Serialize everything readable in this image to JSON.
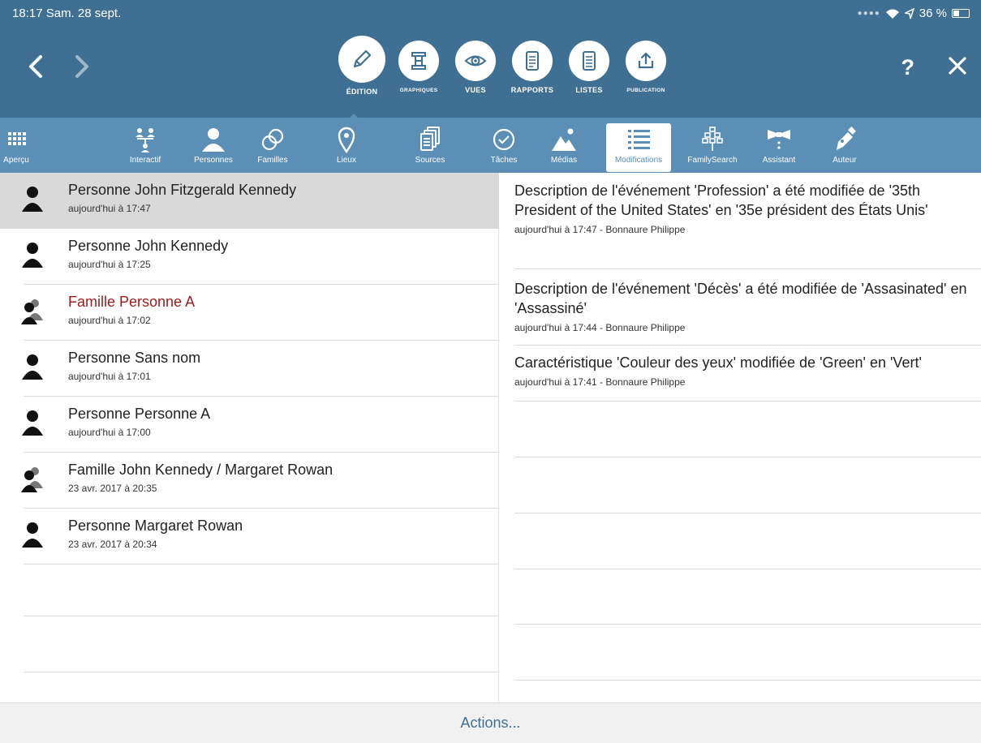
{
  "status": {
    "time": "18:17",
    "date": "Sam. 28 sept.",
    "battery": "36 %"
  },
  "header": {
    "help_label": "?",
    "modes": [
      {
        "label": "ÉDITION",
        "icon": "pencil-icon",
        "active": true
      },
      {
        "label": "GRAPHIQUES",
        "icon": "chart-tree-icon"
      },
      {
        "label": "VUES",
        "icon": "eye-icon"
      },
      {
        "label": "RAPPORTS",
        "icon": "report-icon"
      },
      {
        "label": "LISTES",
        "icon": "list-doc-icon"
      },
      {
        "label": "PUBLICATION",
        "icon": "upload-icon"
      }
    ]
  },
  "toolbar": {
    "items": [
      {
        "label": "Aperçu",
        "icon": "grid-icon"
      },
      {
        "label": "Interactif",
        "icon": "family-tree-icon"
      },
      {
        "label": "Personnes",
        "icon": "person-icon"
      },
      {
        "label": "Familles",
        "icon": "rings-icon"
      },
      {
        "label": "Lieux",
        "icon": "pin-icon"
      },
      {
        "label": "Sources",
        "icon": "documents-icon"
      },
      {
        "label": "Tâches",
        "icon": "check-circle-icon"
      },
      {
        "label": "Médias",
        "icon": "mountain-icon"
      },
      {
        "label": "Modifications",
        "icon": "list-icon",
        "active": true
      },
      {
        "label": "FamilySearch",
        "icon": "familysearch-icon"
      },
      {
        "label": "Assistant",
        "icon": "bowtie-icon"
      },
      {
        "label": "Auteur",
        "icon": "pen-icon"
      }
    ]
  },
  "changes": [
    {
      "title": "Personne John Fitzgerald Kennedy",
      "time": "aujourd'hui à 17:47",
      "kind": "person",
      "selected": true
    },
    {
      "title": "Personne John Kennedy",
      "time": "aujourd'hui à 17:25",
      "kind": "person"
    },
    {
      "title": "Famille Personne A",
      "time": "aujourd'hui à 17:02",
      "kind": "family",
      "highlight": true
    },
    {
      "title": "Personne Sans nom",
      "time": "aujourd'hui à 17:01",
      "kind": "person"
    },
    {
      "title": "Personne Personne A",
      "time": "aujourd'hui à 17:00",
      "kind": "person"
    },
    {
      "title": "Famille John Kennedy / Margaret Rowan",
      "time": "23 avr. 2017 à 20:35",
      "kind": "family"
    },
    {
      "title": "Personne Margaret Rowan",
      "time": "23 avr. 2017 à 20:34",
      "kind": "person"
    }
  ],
  "details": [
    {
      "text": "Description de l'événement 'Profession' a été modifiée de '35th President of the United States' en '35e président des États Unis'",
      "meta": "aujourd'hui à 17:47 - Bonnaure Philippe"
    },
    {
      "text": "Description de l'événement 'Décès' a été modifiée de 'Assasinated' en 'Assassiné'",
      "meta": "aujourd'hui à 17:44 - Bonnaure Philippe"
    },
    {
      "text": "Caractéristique 'Couleur des yeux' modifiée de 'Green' en 'Vert'",
      "meta": "aujourd'hui à 17:41 - Bonnaure Philippe"
    }
  ],
  "footer": {
    "actions_label": "Actions..."
  },
  "colors": {
    "header": "#3f6f93",
    "toolbar": "#5b8fb6",
    "accent_red": "#9c1c1c"
  }
}
